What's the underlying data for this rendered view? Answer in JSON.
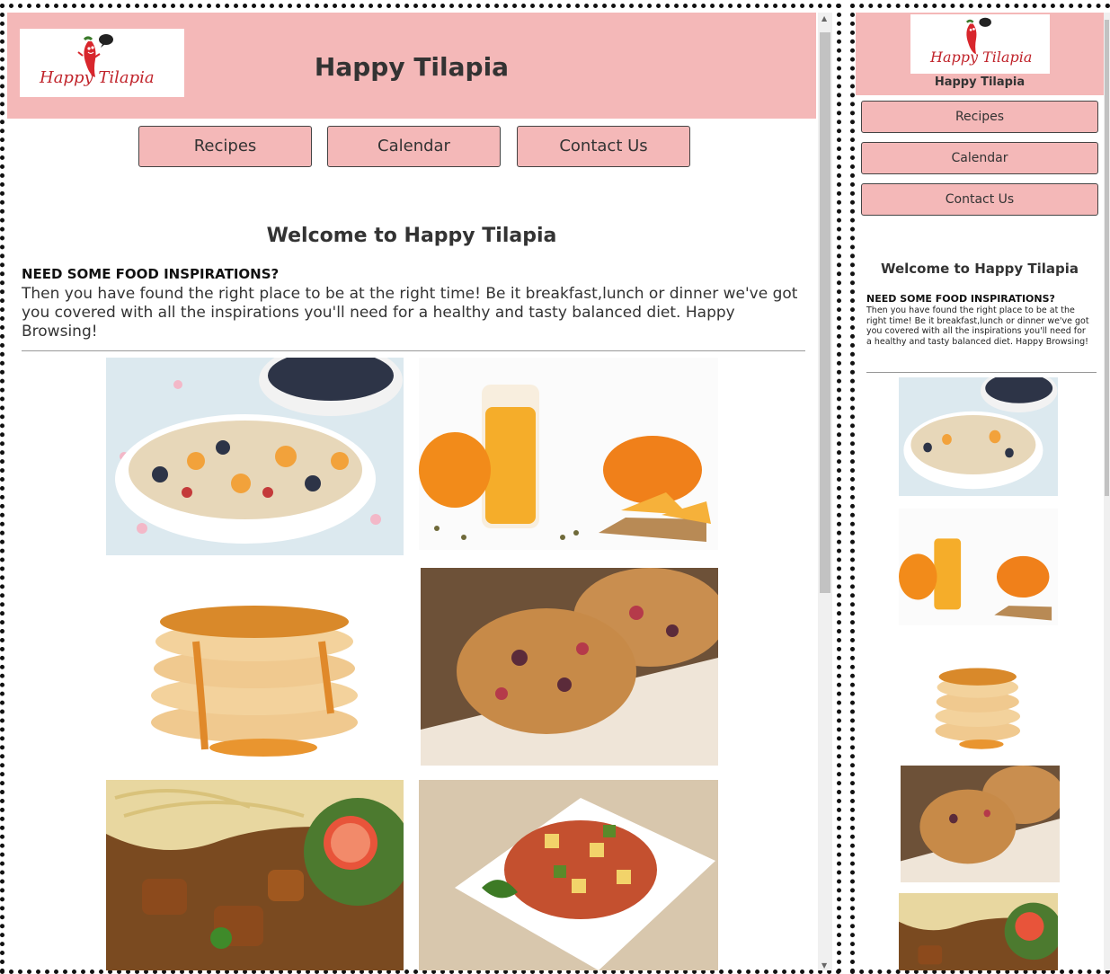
{
  "site": {
    "title": "Happy Tilapia",
    "logo_text": "Happy Tilapia"
  },
  "nav": {
    "items": [
      {
        "label": "Recipes"
      },
      {
        "label": "Calendar"
      },
      {
        "label": "Contact Us"
      }
    ]
  },
  "main": {
    "welcome": "Welcome to Happy Tilapia",
    "subhead": "NEED SOME FOOD INSPIRATIONS?",
    "intro": "Then you have found the right place to be at the right time! Be it breakfast,lunch or dinner we've got you covered with all the inspirations you'll need for a healthy and tasty balanced diet. Happy Browsing!"
  },
  "gallery": {
    "images": [
      {
        "name": "fruit-oat-bowl-image"
      },
      {
        "name": "mango-juice-image"
      },
      {
        "name": "pancake-stack-image"
      },
      {
        "name": "scones-image"
      },
      {
        "name": "noodle-stew-salad-image"
      },
      {
        "name": "diced-veggie-plate-image"
      }
    ]
  },
  "colors": {
    "header_pink": "#f4b8b8",
    "button_pink": "#f4b8b8",
    "logo_red": "#c0232a"
  }
}
